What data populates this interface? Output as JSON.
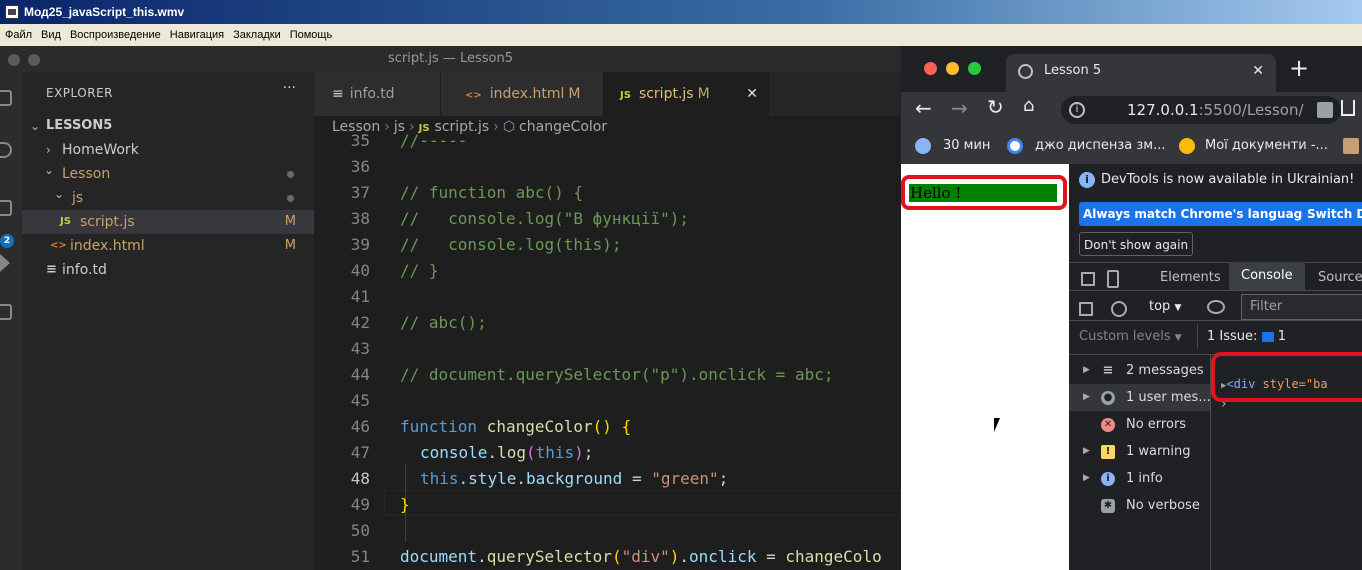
{
  "player": {
    "title": "Мод25_javaScript_this.wmv",
    "menu": [
      "Файл",
      "Вид",
      "Воспроизведение",
      "Навигация",
      "Закладки",
      "Помощь"
    ]
  },
  "vscode": {
    "window_title": "script.js — Lesson5",
    "activity_badge": "2",
    "explorer": {
      "header": "EXPLORER",
      "more": "···",
      "root": "LESSON5",
      "tree": [
        {
          "label": "HomeWork",
          "chev": "›",
          "status": ""
        },
        {
          "label": "Lesson",
          "chev": "⌄",
          "status": "dot"
        },
        {
          "label": "js",
          "chev": "⌄",
          "status": "dot"
        },
        {
          "label": "script.js",
          "icon": "JS",
          "status": "M"
        },
        {
          "label": "index.html",
          "icon": "<>",
          "status": "M"
        },
        {
          "label": "info.td",
          "icon": "≡",
          "status": ""
        }
      ]
    },
    "tabs": [
      {
        "label": "info.td",
        "icon": "≡",
        "status": ""
      },
      {
        "label": "index.html",
        "icon": "<>",
        "status": "M"
      },
      {
        "label": "script.js",
        "icon": "JS",
        "status": "M",
        "close": "✕"
      }
    ],
    "breadcrumb": [
      "Lesson",
      "js",
      "script.js",
      "changeColor"
    ],
    "breadcrumb_icons": {
      "file": "JS",
      "symbol": "⬡"
    },
    "line_numbers": [
      "35",
      "36",
      "37",
      "38",
      "39",
      "40",
      "41",
      "42",
      "43",
      "44",
      "45",
      "46",
      "47",
      "48",
      "49",
      "50",
      "51"
    ],
    "current_line": "48",
    "code": {
      "l35": "//-----",
      "l37": "// function abc() {",
      "l38": "//   console.log(\"В функції\");",
      "l39": "//   console.log(this);",
      "l40": "// }",
      "l42": "// abc();",
      "l44": "// document.querySelector(\"p\").onclick = abc;",
      "l46_kw": "function",
      "l46_fn": "changeColor",
      "l46_paren": "()",
      "l46_brace": "{",
      "l47_obj": "console",
      "l47_dot": ".",
      "l47_fn": "log",
      "l47_open": "(",
      "l47_this": "this",
      "l47_close": ")",
      "l47_end": ";",
      "l48_this": "this",
      "l48_dot1": ".",
      "l48_style": "style",
      "l48_dot2": ".",
      "l48_bg": "background",
      "l48_eq": " = ",
      "l48_str": "\"green\"",
      "l48_end": ";",
      "l49": "}",
      "l51_obj": "document",
      "l51_dot1": ".",
      "l51_fn": "querySelector",
      "l51_open": "(",
      "l51_str": "\"div\"",
      "l51_close": ")",
      "l51_dot2": ".",
      "l51_prop": "onclick",
      "l51_eq": " = ",
      "l51_val": "changeColo"
    }
  },
  "chrome": {
    "tab_title": "Lesson 5",
    "tab_close": "✕",
    "new_tab": "+",
    "url_host": "127.0.0.1",
    "url_rest": ":5500/Lesson/",
    "bookmarks": [
      "30 мин",
      "джо диспенза зм...",
      "Мої документи -..."
    ],
    "page_text": "Hello !",
    "accent_green": "#008000",
    "highlight_red": "#e0141e"
  },
  "devtools": {
    "info_banner": "DevTools is now available in Ukrainian!",
    "btn_match": "Always match Chrome's language",
    "btn_switch": "Switch D",
    "btn_dont": "Don't show again",
    "tabs": [
      "Elements",
      "Console",
      "Source"
    ],
    "active_tab": "Console",
    "context": "top",
    "filter_placeholder": "Filter",
    "custom_levels": "Custom levels",
    "issues_label": "1 Issue:",
    "issues_count": "1",
    "sidebar": [
      {
        "label": "2 messages",
        "icon": "list-icon"
      },
      {
        "label": "1 user mes...",
        "icon": "user-icon"
      },
      {
        "label": "No errors",
        "icon": "error-icon"
      },
      {
        "label": "1 warning",
        "icon": "warning-icon"
      },
      {
        "label": "1 info",
        "icon": "info-icon"
      },
      {
        "label": "No verbose",
        "icon": "bug-icon"
      }
    ],
    "log_tag": "<div",
    "log_attr": " style=\"ba",
    "prompt": "›"
  }
}
